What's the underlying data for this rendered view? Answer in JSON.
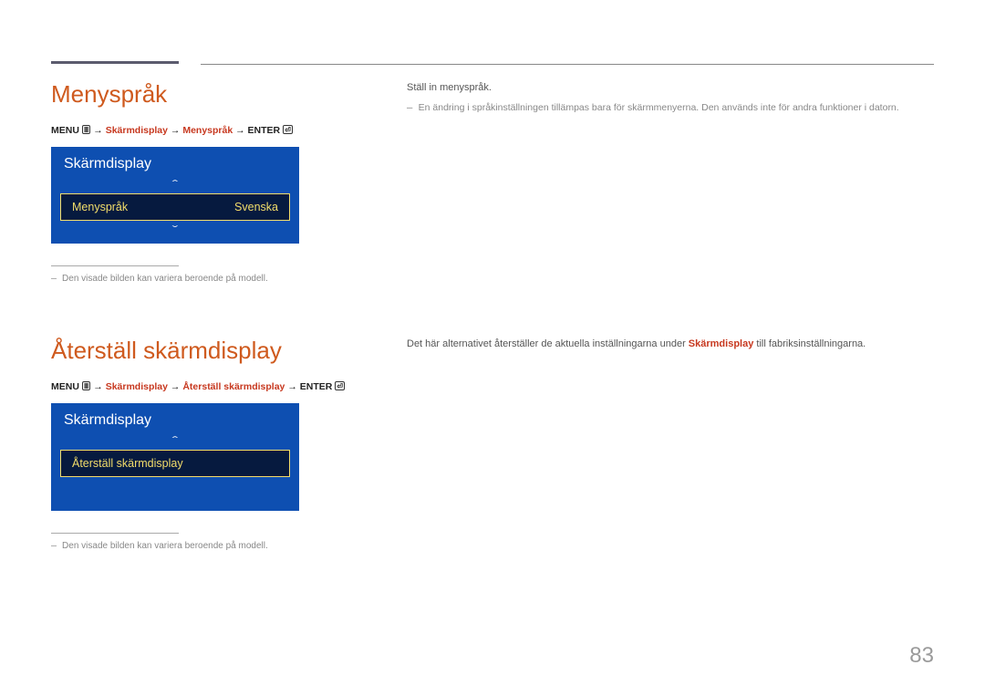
{
  "page_number": "83",
  "section1": {
    "heading": "Menyspråk",
    "breadcrumb": {
      "menu_label": "MENU",
      "arrow": "→",
      "p1": "Skärmdisplay",
      "p2": "Menyspråk",
      "enter_label": "ENTER"
    },
    "osd": {
      "title": "Skärmdisplay",
      "row_label": "Menyspråk",
      "row_value": "Svenska"
    },
    "footnote": "Den visade bilden kan variera beroende på modell.",
    "right": {
      "line1": "Ställ in menyspråk.",
      "note": "En ändring i språkinställningen tillämpas bara för skärmmenyerna. Den används inte för andra funktioner i datorn."
    }
  },
  "section2": {
    "heading": "Återställ skärmdisplay",
    "breadcrumb": {
      "menu_label": "MENU",
      "arrow": "→",
      "p1": "Skärmdisplay",
      "p2": "Återställ skärmdisplay",
      "enter_label": "ENTER"
    },
    "osd": {
      "title": "Skärmdisplay",
      "row_label": "Återställ skärmdisplay"
    },
    "footnote": "Den visade bilden kan variera beroende på modell.",
    "right": {
      "pre": "Det här alternativet återställer de aktuella inställningarna under ",
      "hl": "Skärmdisplay",
      "post": " till fabriksinställningarna."
    }
  }
}
